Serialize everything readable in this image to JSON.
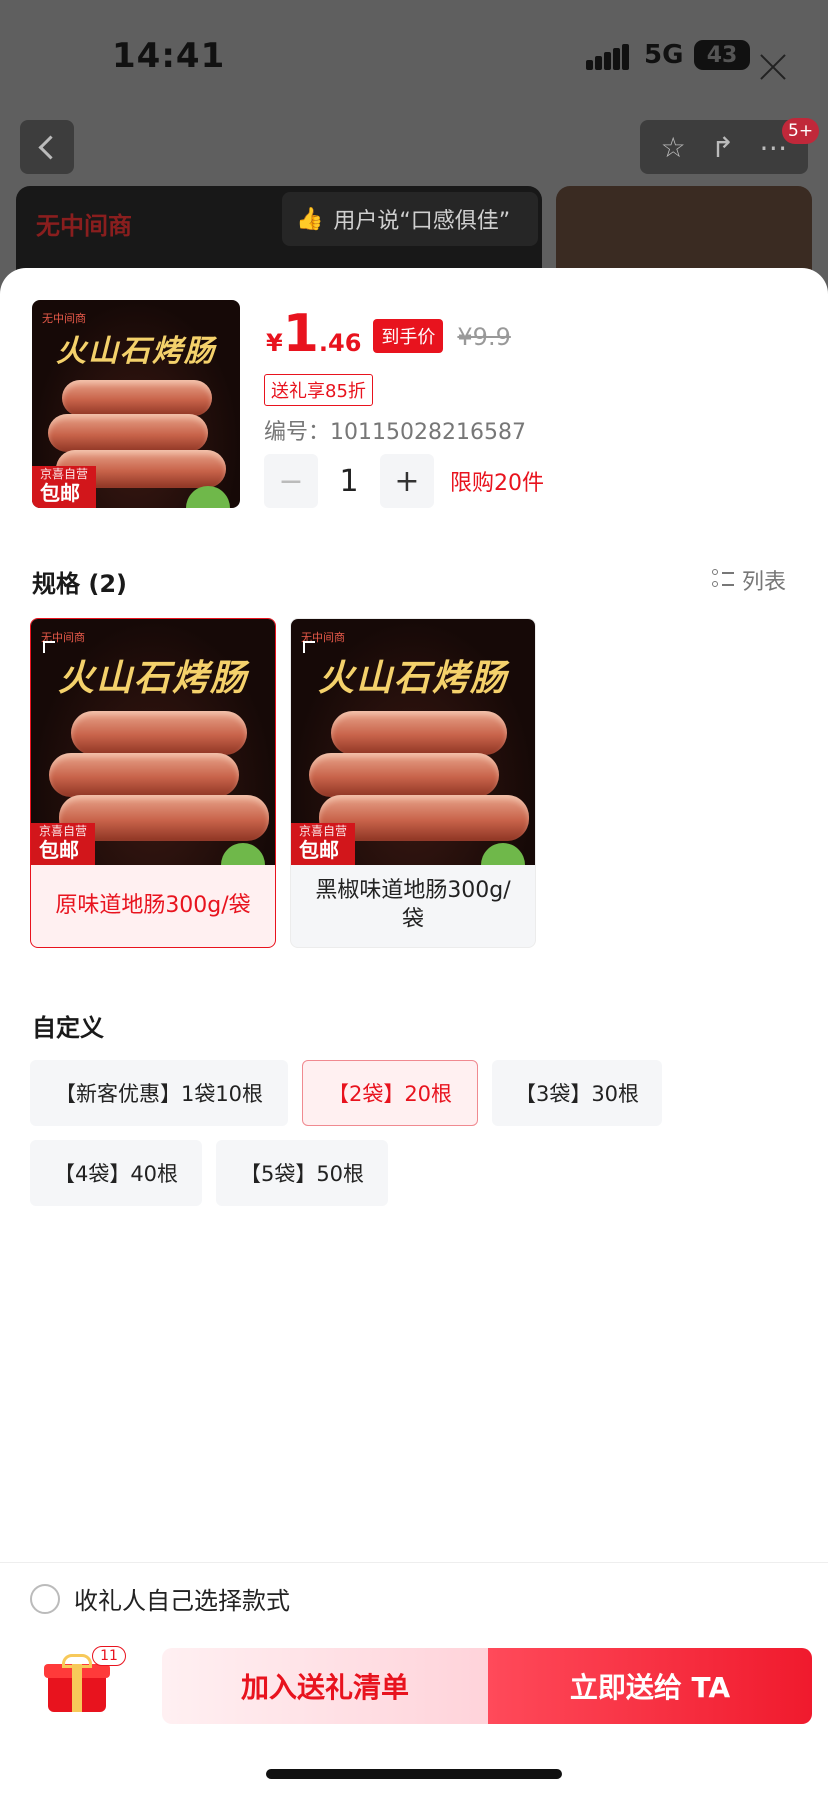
{
  "status_bar": {
    "time": "14:41",
    "network": "5G",
    "battery": "43"
  },
  "background_page": {
    "brand_text": "无中间商",
    "review_text": "用户说“口感俱佳”",
    "badge": "5+"
  },
  "product": {
    "image": {
      "brand": "无中间商",
      "title": "火山石烤肠",
      "tag_top": "京喜自营",
      "tag_bottom": "包邮"
    },
    "price_symbol": "¥",
    "price_integer": "1",
    "price_decimal": ".46",
    "price_chip": "到手价",
    "original_price": "¥9.9",
    "promo_tag": "送礼享85折",
    "item_no_label": "编号：",
    "item_no": "10115028216587",
    "quantity": "1",
    "quantity_minus": "−",
    "quantity_plus": "+",
    "limit_text": "限购20件"
  },
  "spec": {
    "title": "规格 (2)",
    "list_toggle": "列表",
    "options": [
      {
        "label": "原味道地肠300g/袋",
        "selected": true
      },
      {
        "label": "黑椒味道地肠300g/袋",
        "selected": false
      }
    ]
  },
  "custom": {
    "title": "自定义",
    "options": [
      {
        "label": "【新客优惠】1袋10根",
        "selected": false
      },
      {
        "label": "【2袋】20根",
        "selected": true
      },
      {
        "label": "【3袋】30根",
        "selected": false
      },
      {
        "label": "【4袋】40根",
        "selected": false
      },
      {
        "label": "【5袋】50根",
        "selected": false
      }
    ]
  },
  "footer": {
    "self_choose_label": "收礼人自己选择款式",
    "gift_count": "11",
    "add_button": "加入送礼清单",
    "send_button": "立即送给 TA"
  },
  "colors": {
    "accent": "#e8131e",
    "selected_bg": "#fff0f1"
  }
}
